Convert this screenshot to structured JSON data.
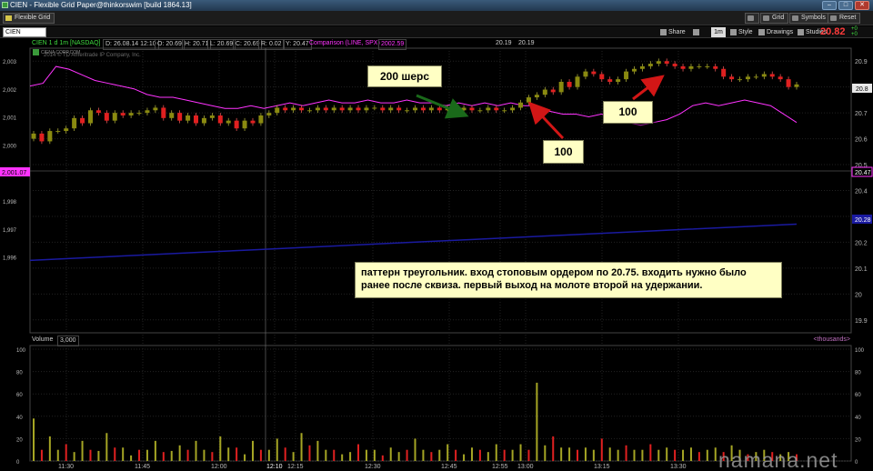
{
  "window": {
    "title": "CIEN - Flexible Grid Paper@thinkorswim [build 1864.13]",
    "tab": "Flexible Grid",
    "buttons": {
      "grid": "Grid",
      "symbols": "Symbols",
      "reset": "Reset"
    }
  },
  "symbol_bar": {
    "symbol": "CIEN",
    "share": "Share",
    "timeframe": "1m",
    "style": "Style",
    "drawings": "Drawings",
    "studies": "Studies",
    "last_price": "20.82",
    "change_top": "+0",
    "change_bottom": "+0"
  },
  "chart_header": {
    "instrument": "CIEN 1 d 1m [NASDAQ]",
    "date": "D: 26.08.14 12:10",
    "open": "O: 20.69",
    "high": "H: 20.71",
    "low": "L: 20.69",
    "close": "C: 20.69",
    "range": "R: 0.02",
    "y": "Y: 20.47",
    "comparison": "Comparison (LINE, SPX)",
    "comparison_value": "2002.59",
    "price_marker": "20.19",
    "price_marker2": "20.19",
    "company": "CIENA CORP.COM",
    "copyright": "2014 © TD Ameritrade IP Company, Inc."
  },
  "annotations": {
    "shares_200": "200 шерс",
    "exit_100_first": "100",
    "exit_100_second": "100",
    "comment": "паттерн треугольник. вход стоповым ордером по 20.75. входить нужно было ранее после сквиза. первый выход на молоте второй на удержании."
  },
  "price_axis": {
    "labels": [
      "20.9",
      "20.8",
      "20.7",
      "20.6",
      "20.5",
      "20.4",
      "20.3",
      "20.2",
      "20.1",
      "20",
      "19.9"
    ],
    "badges": {
      "last": "20.8",
      "comparison": "20.47",
      "ma": "20.28"
    }
  },
  "comparison_axis": {
    "labels": [
      "2,003",
      "2,002",
      "2,001",
      "2,000",
      "1,999",
      "1,998",
      "1,997",
      "1,996"
    ],
    "badge": "2,001.07"
  },
  "volume_panel": {
    "label": "Volume",
    "value": "3,000",
    "units": "<thousands>",
    "axis_labels": [
      "100",
      "80",
      "60",
      "40",
      "20",
      "0"
    ]
  },
  "time_axis": {
    "labels": [
      "11:30",
      "11:45",
      "12:00",
      "12:10",
      "12:15",
      "12:30",
      "12:45",
      "12:55",
      "13:00",
      "13:15",
      "13:30"
    ]
  },
  "colors": {
    "up_candle": "#8a8a10",
    "down_candle": "#e02020",
    "comparison_line": "#ff33ff",
    "moving_average": "#1a1aa0",
    "arrow_green": "#1a6a1a",
    "arrow_red": "#d21616"
  },
  "chart_data": {
    "type": "candlestick",
    "price_range": [
      19.85,
      20.95
    ],
    "candles": [
      {
        "o": 20.6,
        "c": 20.62
      },
      {
        "o": 20.62,
        "c": 20.59
      },
      {
        "o": 20.59,
        "c": 20.63
      },
      {
        "o": 20.63,
        "c": 20.63
      },
      {
        "o": 20.63,
        "c": 20.64
      },
      {
        "o": 20.64,
        "c": 20.68
      },
      {
        "o": 20.68,
        "c": 20.66
      },
      {
        "o": 20.66,
        "c": 20.71
      },
      {
        "o": 20.71,
        "c": 20.7
      },
      {
        "o": 20.7,
        "c": 20.67
      },
      {
        "o": 20.67,
        "c": 20.7
      },
      {
        "o": 20.7,
        "c": 20.69
      },
      {
        "o": 20.69,
        "c": 20.7
      },
      {
        "o": 20.7,
        "c": 20.7
      },
      {
        "o": 20.7,
        "c": 20.71
      },
      {
        "o": 20.71,
        "c": 20.72
      },
      {
        "o": 20.72,
        "c": 20.68
      },
      {
        "o": 20.68,
        "c": 20.7
      },
      {
        "o": 20.7,
        "c": 20.67
      },
      {
        "o": 20.67,
        "c": 20.69
      },
      {
        "o": 20.69,
        "c": 20.66
      },
      {
        "o": 20.66,
        "c": 20.68
      },
      {
        "o": 20.68,
        "c": 20.69
      },
      {
        "o": 20.69,
        "c": 20.66
      },
      {
        "o": 20.66,
        "c": 20.67
      },
      {
        "o": 20.67,
        "c": 20.64
      },
      {
        "o": 20.64,
        "c": 20.67
      },
      {
        "o": 20.67,
        "c": 20.66
      },
      {
        "o": 20.66,
        "c": 20.69
      },
      {
        "o": 20.69,
        "c": 20.7
      },
      {
        "o": 20.7,
        "c": 20.72
      },
      {
        "o": 20.72,
        "c": 20.71
      },
      {
        "o": 20.71,
        "c": 20.72
      },
      {
        "o": 20.72,
        "c": 20.71
      },
      {
        "o": 20.71,
        "c": 20.71
      },
      {
        "o": 20.71,
        "c": 20.72
      },
      {
        "o": 20.72,
        "c": 20.71
      },
      {
        "o": 20.71,
        "c": 20.72
      },
      {
        "o": 20.72,
        "c": 20.71
      },
      {
        "o": 20.71,
        "c": 20.72
      },
      {
        "o": 20.72,
        "c": 20.71
      },
      {
        "o": 20.71,
        "c": 20.72
      },
      {
        "o": 20.72,
        "c": 20.72
      },
      {
        "o": 20.72,
        "c": 20.71
      },
      {
        "o": 20.71,
        "c": 20.72
      },
      {
        "o": 20.72,
        "c": 20.71
      },
      {
        "o": 20.71,
        "c": 20.71
      },
      {
        "o": 20.71,
        "c": 20.72
      },
      {
        "o": 20.72,
        "c": 20.71
      },
      {
        "o": 20.71,
        "c": 20.72
      },
      {
        "o": 20.72,
        "c": 20.71
      },
      {
        "o": 20.71,
        "c": 20.72
      },
      {
        "o": 20.72,
        "c": 20.71
      },
      {
        "o": 20.71,
        "c": 20.72
      },
      {
        "o": 20.72,
        "c": 20.71
      },
      {
        "o": 20.71,
        "c": 20.71
      },
      {
        "o": 20.71,
        "c": 20.72
      },
      {
        "o": 20.72,
        "c": 20.71
      },
      {
        "o": 20.71,
        "c": 20.71
      },
      {
        "o": 20.71,
        "c": 20.72
      },
      {
        "o": 20.72,
        "c": 20.74
      },
      {
        "o": 20.74,
        "c": 20.76
      },
      {
        "o": 20.76,
        "c": 20.77
      },
      {
        "o": 20.77,
        "c": 20.79
      },
      {
        "o": 20.79,
        "c": 20.78
      },
      {
        "o": 20.78,
        "c": 20.82
      },
      {
        "o": 20.82,
        "c": 20.8
      },
      {
        "o": 20.8,
        "c": 20.84
      },
      {
        "o": 20.84,
        "c": 20.86
      },
      {
        "o": 20.86,
        "c": 20.85
      },
      {
        "o": 20.85,
        "c": 20.83
      },
      {
        "o": 20.83,
        "c": 20.82
      },
      {
        "o": 20.82,
        "c": 20.83
      },
      {
        "o": 20.83,
        "c": 20.86
      },
      {
        "o": 20.86,
        "c": 20.87
      },
      {
        "o": 20.87,
        "c": 20.88
      },
      {
        "o": 20.88,
        "c": 20.89
      },
      {
        "o": 20.89,
        "c": 20.9
      },
      {
        "o": 20.9,
        "c": 20.89
      },
      {
        "o": 20.89,
        "c": 20.88
      },
      {
        "o": 20.88,
        "c": 20.87
      },
      {
        "o": 20.87,
        "c": 20.88
      },
      {
        "o": 20.88,
        "c": 20.88
      },
      {
        "o": 20.88,
        "c": 20.88
      },
      {
        "o": 20.88,
        "c": 20.87
      },
      {
        "o": 20.87,
        "c": 20.84
      },
      {
        "o": 20.84,
        "c": 20.83
      },
      {
        "o": 20.83,
        "c": 20.83
      },
      {
        "o": 20.83,
        "c": 20.84
      },
      {
        "o": 20.84,
        "c": 20.84
      },
      {
        "o": 20.84,
        "c": 20.85
      },
      {
        "o": 20.85,
        "c": 20.84
      },
      {
        "o": 20.84,
        "c": 20.83
      },
      {
        "o": 20.83,
        "c": 20.8
      },
      {
        "o": 20.8,
        "c": 20.81
      }
    ],
    "comparison_series": [
      2002.2,
      2002.3,
      2002.9,
      2002.8,
      2002.6,
      2002.4,
      2002.3,
      2002.2,
      2002.1,
      2001.9,
      2001.8,
      2001.8,
      2001.7,
      2001.6,
      2001.5,
      2001.4,
      2001.4,
      2001.5,
      2001.4,
      2001.5,
      2001.6,
      2001.5,
      2001.6,
      2001.7,
      2001.6,
      2001.6,
      2001.7,
      2001.6,
      2001.6,
      2001.7,
      2001.6,
      2001.6,
      2001.5,
      2001.6,
      2001.5,
      2001.6,
      2001.5,
      2001.6,
      2001.5,
      2001.5,
      2001.3,
      2001.2,
      2001.2,
      2001.1,
      2001.2,
      2001.0,
      2000.9,
      2000.8,
      2000.9,
      2001.0,
      2001.2,
      2001.5,
      2001.6,
      2001.5,
      2001.6,
      2001.7,
      2001.6,
      2001.5,
      2001.2,
      2000.9
    ],
    "moving_average": [
      20.13,
      20.14,
      20.15,
      20.16,
      20.17,
      20.18,
      20.19,
      20.2,
      20.21,
      20.22,
      20.23,
      20.24,
      20.25,
      20.26,
      20.27
    ],
    "volume": [
      38,
      10,
      22,
      10,
      15,
      8,
      18,
      10,
      9,
      25,
      12,
      12,
      5,
      10,
      10,
      18,
      8,
      9,
      14,
      10,
      18,
      10,
      8,
      22,
      12,
      12,
      6,
      18,
      10,
      10,
      20,
      12,
      8,
      25,
      14,
      18,
      10,
      10,
      6,
      8,
      15,
      10,
      10,
      5,
      12,
      8,
      10,
      20,
      10,
      8,
      10,
      15,
      10,
      6,
      12,
      10,
      8,
      15,
      10,
      10,
      15,
      10,
      70,
      14,
      22,
      12,
      12,
      10,
      12,
      10,
      20,
      12,
      10,
      14,
      10,
      10,
      15,
      10,
      12,
      10,
      10,
      12,
      8,
      10,
      12,
      8,
      14,
      10,
      6,
      8,
      10,
      8,
      6,
      8,
      6
    ]
  }
}
